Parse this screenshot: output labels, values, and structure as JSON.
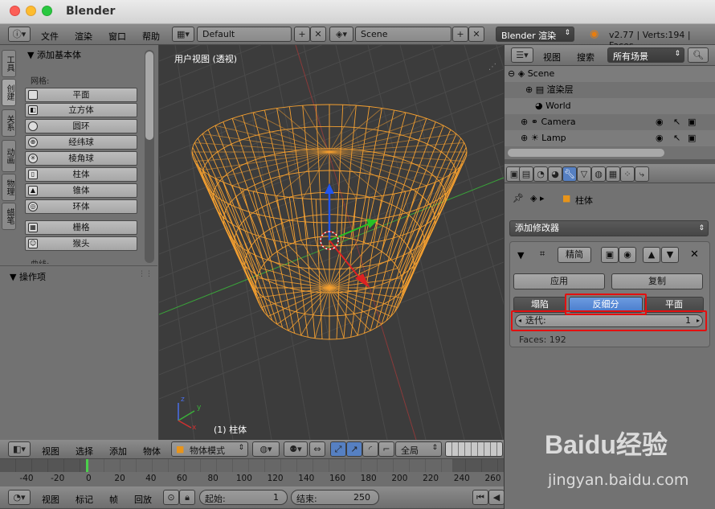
{
  "window": {
    "title": "Blender"
  },
  "info_header": {
    "menus": [
      "文件",
      "渲染",
      "窗口",
      "帮助"
    ],
    "screen_layout": "Default",
    "scene": "Scene",
    "render_engine": "Blender 渲染",
    "stats": "v2.77 | Verts:194 | Faces"
  },
  "tool_tabs": [
    "工具",
    "创建",
    "关系",
    "动画",
    "物理",
    "蜡笔"
  ],
  "tool_panel": {
    "section_title": "添加基本体",
    "mesh_label": "网格:",
    "mesh_buttons": [
      "平面",
      "立方体",
      "圆环",
      "经纬球",
      "棱角球",
      "柱体",
      "锥体",
      "环体"
    ],
    "extra_buttons": [
      "栅格",
      "猴头"
    ],
    "curve_label": "曲线:",
    "operator_title": "操作项"
  },
  "viewport": {
    "view_label": "用户视图 (透视)",
    "object_label": "(1) 柱体",
    "axis_x": "x",
    "axis_y": "y",
    "axis_z": "z"
  },
  "view3d_header": {
    "menus": [
      "视图",
      "选择",
      "添加",
      "物体"
    ],
    "mode": "物体模式",
    "pivot": "全局"
  },
  "timeline": {
    "ticks": [
      "-40",
      "-20",
      "0",
      "20",
      "40",
      "60",
      "80",
      "100",
      "120",
      "140",
      "160",
      "180",
      "200",
      "220",
      "240",
      "260"
    ],
    "current_frame": 0
  },
  "bottom_bar": {
    "menus": [
      "视图",
      "标记",
      "帧",
      "回放"
    ],
    "start_label": "起始:",
    "start_value": "1",
    "end_label": "结束:",
    "end_value": "250"
  },
  "outliner_header": {
    "menus": [
      "视图",
      "搜索"
    ],
    "scene_filter": "所有场景"
  },
  "outliner": {
    "items": [
      "Scene",
      "渲染层",
      "World",
      "Camera",
      "Lamp"
    ]
  },
  "properties": {
    "breadcrumb_object": "柱体",
    "add_modifier": "添加修改器",
    "modifier_name": "精简",
    "apply_label": "应用",
    "copy_label": "复制",
    "mode_tabs": [
      "塌陷",
      "反细分",
      "平面"
    ],
    "active_mode": "反细分",
    "iterations_label": "迭代:",
    "iterations_value": "1",
    "faces_info": "Faces: 192"
  },
  "watermark": {
    "text": "Baidu经验",
    "url": "jingyan.baidu.com"
  },
  "colors": {
    "wire": "#f5a030",
    "accent": "#5680c2",
    "highlight": "#e31010"
  }
}
